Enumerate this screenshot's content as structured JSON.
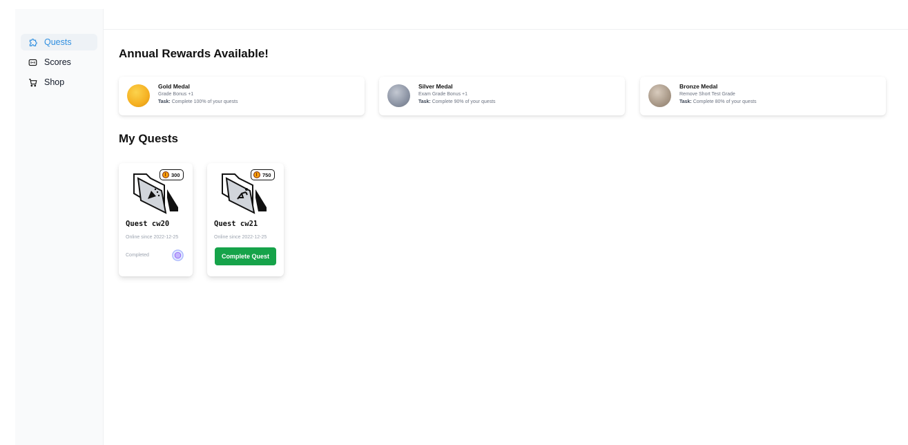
{
  "sidebar": {
    "items": [
      {
        "label": "Quests",
        "icon": "puzzle-icon",
        "active": true
      },
      {
        "label": "Scores",
        "icon": "scoreboard-icon",
        "active": false
      },
      {
        "label": "Shop",
        "icon": "cart-icon",
        "active": false
      }
    ]
  },
  "rewards_section": {
    "title": "Annual Rewards Available!",
    "task_label": "Task:",
    "rewards": [
      {
        "name": "Gold Medal",
        "bonus": "Grade Bonus +1",
        "task": "Complete 100% of your quests",
        "color": "#f5b021"
      },
      {
        "name": "Silver Medal",
        "bonus": "Exam Grade Bonus +1",
        "task": "Complete 90% of your quests",
        "color": "#8b93a3"
      },
      {
        "name": "Bronze Medal",
        "bonus": "Remove Short Test Grade",
        "task": "Complete 80% of your quests",
        "color": "#a89887"
      }
    ]
  },
  "quests_section": {
    "title": "My Quests",
    "quests": [
      {
        "title": "Quest cw20",
        "coins": "300",
        "since": "Online since 2022-12-25",
        "status": "Completed",
        "icon": "confetti-icon"
      },
      {
        "title": "Quest cw21",
        "coins": "750",
        "since": "Online since 2022-12-25",
        "button": "Complete Quest",
        "icon": "running-figure-icon"
      }
    ]
  },
  "colors": {
    "accent": "#2f8fe0",
    "success": "#16a34a"
  }
}
